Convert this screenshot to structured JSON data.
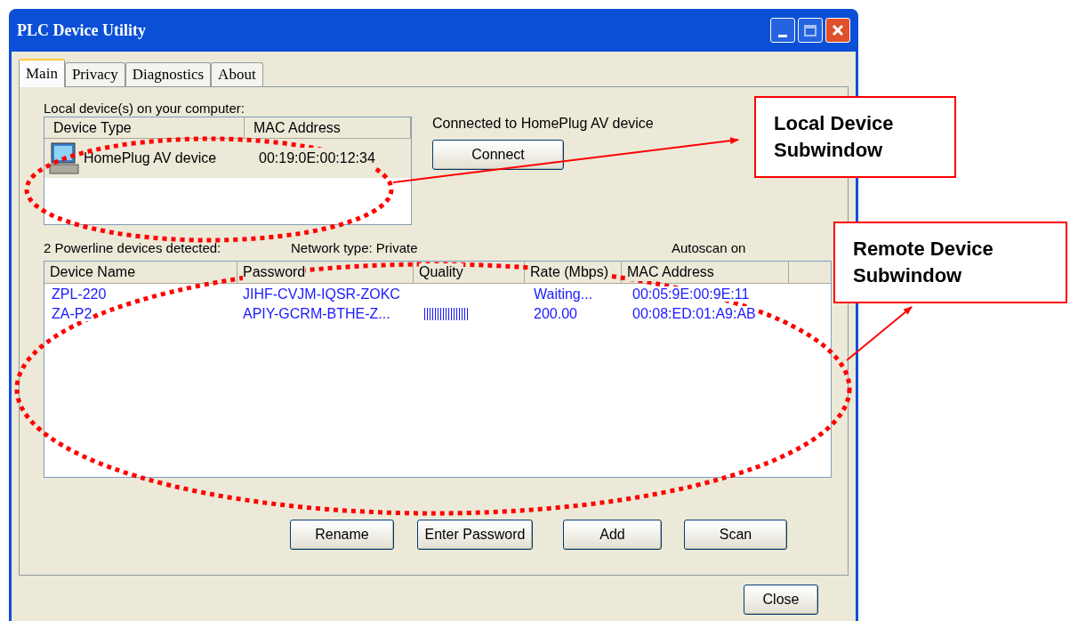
{
  "window": {
    "title": "PLC Device Utility"
  },
  "tabs": [
    {
      "label": "Main",
      "selected": true
    },
    {
      "label": "Privacy",
      "selected": false
    },
    {
      "label": "Diagnostics",
      "selected": false
    },
    {
      "label": "About",
      "selected": false
    }
  ],
  "local": {
    "label": "Local device(s) on your computer:",
    "columns": [
      "Device Type",
      "MAC Address"
    ],
    "rows": [
      {
        "device_type": "HomePlug AV device",
        "mac": "00:19:0E:00:12:34"
      }
    ]
  },
  "connection": {
    "status": "Connected to HomePlug AV device",
    "button": "Connect"
  },
  "remote": {
    "detected": "2 Powerline devices detected:",
    "network_type": "Network type: Private",
    "autoscan": "Autoscan on",
    "columns": [
      "Device Name",
      "Password",
      "Quality",
      "Rate (Mbps)",
      "MAC Address"
    ],
    "rows": [
      {
        "name": "ZPL-220",
        "password": "JIHF-CVJM-IQSR-ZOKC",
        "rate": "Waiting...",
        "mac": "00:05:9E:00:9E:11"
      },
      {
        "name": "ZA-P2",
        "password": "APIY-GCRM-BTHE-Z...",
        "level": 0.5,
        "rate": "200.00",
        "mac": "00:08:ED:01:A9:AB"
      }
    ]
  },
  "buttons": [
    "Rename",
    "Enter Password",
    "Add",
    "Scan"
  ],
  "close_button": "Close",
  "annotations": [
    {
      "text": "Local Device Subwindow"
    },
    {
      "text": "Remote Device Subwindow"
    }
  ]
}
